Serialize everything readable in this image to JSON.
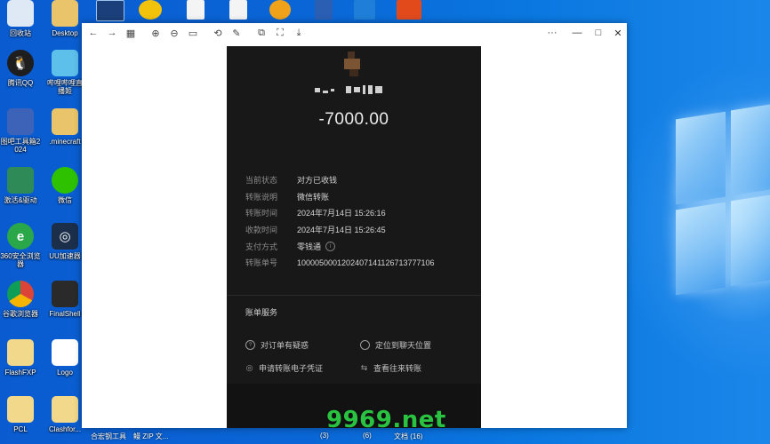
{
  "desktop": {
    "top_icons": [
      "monitor-icon",
      "game-icon",
      "document-icon",
      "document-icon",
      "document-icon",
      "ring-app-icon",
      "word-doc-icon",
      "app-icon",
      "game-shortcut-icon"
    ],
    "icons": [
      {
        "label": "回收站",
        "icon": "recycle-bin-icon",
        "color": "#dfe8f5"
      },
      {
        "label": "Desktop",
        "icon": "folder-icon",
        "color": "#e9c46a"
      },
      {
        "label": "腾讯QQ",
        "icon": "qq-penguin-icon",
        "color": "#1e1e1e"
      },
      {
        "label": "哔哩哔哩直播姬",
        "icon": "bilibili-icon",
        "color": "#5dc0ea"
      },
      {
        "label": "图吧工具箱2024",
        "icon": "toolbox-icon",
        "color": "#3d63b8"
      },
      {
        "label": ".minecraft",
        "icon": "folder-icon",
        "color": "#e9c46a"
      },
      {
        "label": "激活&驱动",
        "icon": "driver-icon",
        "color": "#2e8b57"
      },
      {
        "label": "微信",
        "icon": "wechat-icon",
        "color": "#2dc100"
      },
      {
        "label": "360安全浏览器",
        "icon": "360-browser-icon",
        "color": "#2aa748"
      },
      {
        "label": "UU加速器",
        "icon": "uu-accelerator-icon",
        "color": "#1b2e4a"
      },
      {
        "label": "谷歌浏览器",
        "icon": "chrome-icon",
        "color": "#e8e8e8"
      },
      {
        "label": "FinalShell",
        "icon": "terminal-icon",
        "color": "#2a2a2a"
      },
      {
        "label": "FlashFXP",
        "icon": "folder-icon",
        "color": "#f1d88a"
      },
      {
        "label": "Logo",
        "icon": "image-icon",
        "color": "#ffffff"
      },
      {
        "label": "PCL",
        "icon": "folder-icon",
        "color": "#f1d88a"
      },
      {
        "label": "Clashfor...",
        "icon": "folder-icon",
        "color": "#f1d88a"
      }
    ],
    "bottom_labels": [
      "合宏钢工具",
      "鳗 ZIP 文...",
      "(3)",
      "(6)",
      "文档 (16)"
    ]
  },
  "viewer": {
    "toolbar": [
      "back-icon",
      "forward-icon",
      "grid-icon",
      "zoom-in-icon",
      "zoom-out-icon",
      "actual-size-icon",
      "rotate-icon",
      "edit-icon",
      "copy-icon",
      "crop-icon",
      "save-icon"
    ],
    "controls": {
      "more": "···",
      "minimize": "—",
      "maximize": "□",
      "close": "✕"
    }
  },
  "transfer": {
    "amount": "-7000.00",
    "rows": [
      {
        "label": "当前状态",
        "value": "对方已收钱"
      },
      {
        "label": "转账说明",
        "value": "微信转账"
      },
      {
        "label": "转账时间",
        "value": "2024年7月14日 15:26:16"
      },
      {
        "label": "收款时间",
        "value": "2024年7月14日 15:26:45"
      },
      {
        "label": "支付方式",
        "value": "零钱通",
        "info": "i"
      },
      {
        "label": "转账单号",
        "value": "1000050001202407141126713777106"
      }
    ],
    "service_title": "账单服务",
    "services": [
      {
        "label": "对订单有疑惑",
        "icon": "question-circle-icon",
        "glyph": "?"
      },
      {
        "label": "定位到聊天位置",
        "icon": "chat-bubble-icon",
        "glyph": ""
      },
      {
        "label": "申请转账电子凭证",
        "icon": "certificate-icon",
        "glyph": "◎"
      },
      {
        "label": "查看往来转账",
        "icon": "transfer-arrows-icon",
        "glyph": "⇆"
      }
    ]
  },
  "watermark": "9969.net"
}
